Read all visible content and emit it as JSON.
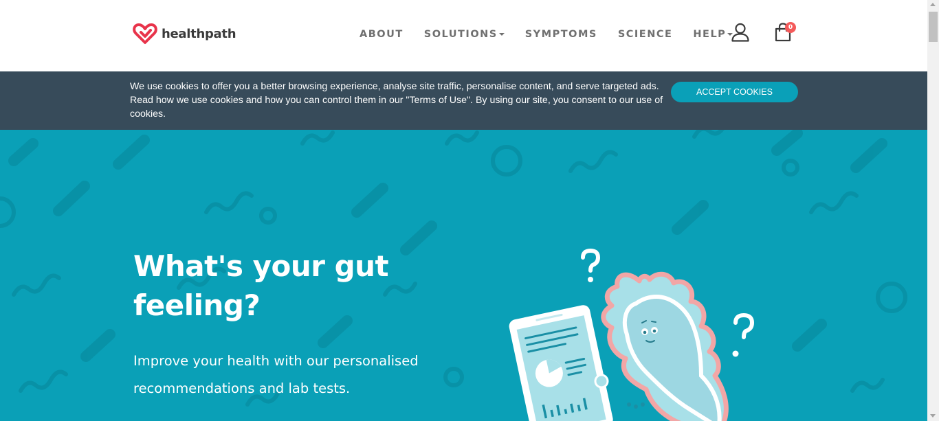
{
  "header": {
    "logo_text": "healthpath",
    "nav": [
      {
        "label": "ABOUT",
        "dropdown": false
      },
      {
        "label": "SOLUTIONS",
        "dropdown": true
      },
      {
        "label": "SYMPTOMS",
        "dropdown": false
      },
      {
        "label": "SCIENCE",
        "dropdown": false
      },
      {
        "label": "HELP",
        "dropdown": true
      }
    ],
    "cart_count": "0",
    "icons": {
      "account": "user-icon",
      "cart": "shopping-bag-icon"
    }
  },
  "cookie": {
    "text": "We use cookies to offer you a better browsing experience, analyse site traffic, personalise content, and serve targeted ads. Read how we use cookies and how you can control them in our \"Terms of Use\". By using our site, you consent to our use of cookies.",
    "accept_label": "ACCEPT COOKIES"
  },
  "hero": {
    "title": "What's your gut feeling?",
    "subtitle": "Improve your health with our personalised recommendations and lab tests."
  },
  "colors": {
    "brand_red": "#e8334a",
    "hero_teal": "#0aa0b7",
    "cookie_bar": "#374b5a",
    "button_teal": "#0aa0b8",
    "badge": "#f45a5a",
    "nav_text": "#6f6f6f"
  }
}
